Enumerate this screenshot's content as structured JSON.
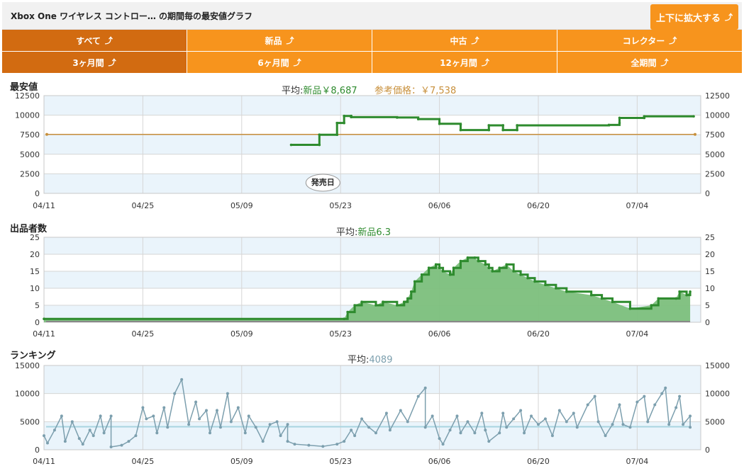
{
  "header": {
    "title": "Xbox One ワイヤレス コントロー…  の期間毎の最安値グラフ",
    "expand_label": "上下に拡大する",
    "expand_icon": "expand-arrow-icon"
  },
  "tabs_type": [
    {
      "label": "すべて",
      "active": true
    },
    {
      "label": "新品",
      "active": false
    },
    {
      "label": "中古",
      "active": false
    },
    {
      "label": "コレクター",
      "active": false
    }
  ],
  "tabs_period": [
    {
      "label": "3ヶ月間",
      "active": true
    },
    {
      "label": "6ヶ月間",
      "active": false
    },
    {
      "label": "12ヶ月間",
      "active": false
    },
    {
      "label": "全期間",
      "active": false
    }
  ],
  "tab_icon": "trend-arrow-icon",
  "colors": {
    "accent": "#f7941d",
    "accent_active": "#d26b11",
    "green": "#2e8b2e",
    "ref": "#c8903c",
    "rank": "#7c9fae"
  },
  "chart_data": [
    {
      "type": "line",
      "title": "最安値",
      "avg_prefix": "平均:",
      "avg_label": "新品￥8,687",
      "ref_label": "参考価格：￥7,538",
      "ylim": [
        0,
        12500
      ],
      "yticks": [
        0,
        2500,
        5000,
        7500,
        10000,
        12500
      ],
      "xticks": [
        "04/11",
        "04/25",
        "05/09",
        "05/23",
        "06/06",
        "06/20",
        "07/04"
      ],
      "annotation": {
        "label": "発売日",
        "x": 39.5
      },
      "reference": {
        "name": "参考価格",
        "value": 7538
      },
      "series": [
        {
          "name": "新品",
          "points": [
            [
              35,
              6200
            ],
            [
              39,
              6200
            ],
            [
              39,
              7500
            ],
            [
              41.5,
              7500
            ],
            [
              41.5,
              9000
            ],
            [
              42.5,
              9000
            ],
            [
              42.5,
              9900
            ],
            [
              43.5,
              9900
            ],
            [
              43.5,
              9750
            ],
            [
              50,
              9700
            ],
            [
              53,
              9500
            ],
            [
              56,
              8900
            ],
            [
              59,
              8800
            ],
            [
              59,
              8100
            ],
            [
              63,
              8100
            ],
            [
              63,
              8700
            ],
            [
              65,
              8700
            ],
            [
              65,
              8100
            ],
            [
              67,
              8100
            ],
            [
              67,
              8700
            ],
            [
              80,
              8750
            ],
            [
              81.5,
              9000
            ],
            [
              81.5,
              9650
            ],
            [
              85,
              9650
            ],
            [
              85,
              9850
            ],
            [
              92,
              9850
            ]
          ]
        }
      ]
    },
    {
      "type": "area",
      "title": "出品者数",
      "avg_prefix": "平均:",
      "avg_label": "新品6.3",
      "ylim": [
        0,
        25
      ],
      "yticks": [
        0,
        5,
        10,
        15,
        20,
        25
      ],
      "xticks": [
        "04/11",
        "04/25",
        "05/09",
        "05/23",
        "06/06",
        "06/20",
        "07/04"
      ],
      "series": [
        {
          "name": "新品",
          "points": [
            [
              0,
              1
            ],
            [
              42.5,
              1
            ],
            [
              43,
              3
            ],
            [
              44,
              5
            ],
            [
              45,
              6
            ],
            [
              47,
              5
            ],
            [
              48,
              6
            ],
            [
              50,
              5
            ],
            [
              51,
              6
            ],
            [
              51.5,
              7
            ],
            [
              52,
              9
            ],
            [
              52.5,
              12
            ],
            [
              53.5,
              14
            ],
            [
              54.5,
              16
            ],
            [
              55.5,
              17
            ],
            [
              56,
              16
            ],
            [
              56.5,
              15
            ],
            [
              57.5,
              14
            ],
            [
              58,
              16
            ],
            [
              59,
              18
            ],
            [
              60,
              19
            ],
            [
              61,
              19
            ],
            [
              61.5,
              18
            ],
            [
              62.5,
              17
            ],
            [
              63,
              16
            ],
            [
              63.5,
              15
            ],
            [
              64.5,
              16
            ],
            [
              65.5,
              17
            ],
            [
              66.5,
              15
            ],
            [
              67.5,
              14
            ],
            [
              68.5,
              13
            ],
            [
              69.5,
              12
            ],
            [
              71,
              11
            ],
            [
              72.5,
              10
            ],
            [
              74,
              9
            ],
            [
              77.5,
              8
            ],
            [
              79,
              7
            ],
            [
              80.5,
              6
            ],
            [
              83,
              4
            ],
            [
              86,
              5
            ],
            [
              87,
              7
            ],
            [
              89.5,
              7
            ],
            [
              90,
              9
            ],
            [
              91,
              8
            ],
            [
              91.5,
              9
            ]
          ]
        }
      ]
    },
    {
      "type": "line",
      "title": "ランキング",
      "avg_prefix": "平均:",
      "avg_label": "4089",
      "avg_value": 4089,
      "ylim": [
        0,
        15000
      ],
      "yticks": [
        0,
        5000,
        10000,
        15000
      ],
      "xticks": [
        "04/11",
        "04/25",
        "05/09",
        "05/23",
        "06/06",
        "06/20",
        "07/04"
      ],
      "series": [
        {
          "name": "ランキング",
          "points": [
            [
              0,
              2500
            ],
            [
              0.5,
              1200
            ],
            [
              1.5,
              3500
            ],
            [
              2.5,
              6000
            ],
            [
              3,
              1500
            ],
            [
              4,
              5000
            ],
            [
              5,
              2000
            ],
            [
              5.5,
              1000
            ],
            [
              6.5,
              3500
            ],
            [
              7,
              2500
            ],
            [
              8,
              6000
            ],
            [
              8.5,
              3000
            ],
            [
              9.5,
              6000
            ],
            [
              9.5,
              500
            ],
            [
              11,
              800
            ],
            [
              12,
              1500
            ],
            [
              13,
              2500
            ],
            [
              14,
              7500
            ],
            [
              14.5,
              5500
            ],
            [
              15.5,
              6000
            ],
            [
              16,
              3000
            ],
            [
              17,
              7500
            ],
            [
              17.5,
              4000
            ],
            [
              18.5,
              10000
            ],
            [
              19.5,
              12500
            ],
            [
              20.5,
              4500
            ],
            [
              21.5,
              8500
            ],
            [
              22,
              5500
            ],
            [
              23,
              7000
            ],
            [
              23.5,
              3000
            ],
            [
              24.5,
              7000
            ],
            [
              25,
              4000
            ],
            [
              26,
              10000
            ],
            [
              26.5,
              5000
            ],
            [
              27.5,
              7500
            ],
            [
              28.5,
              3000
            ],
            [
              29,
              6000
            ],
            [
              30,
              4000
            ],
            [
              31,
              1500
            ],
            [
              32,
              4500
            ],
            [
              33,
              5000
            ],
            [
              33.5,
              2500
            ],
            [
              34.5,
              4500
            ],
            [
              34.5,
              1500
            ],
            [
              35.5,
              1000
            ],
            [
              37.5,
              800
            ],
            [
              39.5,
              600
            ],
            [
              41.5,
              1000
            ],
            [
              42.5,
              1500
            ],
            [
              43.5,
              3500
            ],
            [
              44,
              2500
            ],
            [
              45,
              5500
            ],
            [
              46,
              4000
            ],
            [
              47,
              3000
            ],
            [
              48.5,
              6500
            ],
            [
              49,
              3500
            ],
            [
              50.5,
              7000
            ],
            [
              51.5,
              5000
            ],
            [
              53,
              9500
            ],
            [
              54,
              11000
            ],
            [
              54,
              4000
            ],
            [
              55,
              6000
            ],
            [
              56,
              2000
            ],
            [
              56.5,
              1000
            ],
            [
              57.5,
              3500
            ],
            [
              58.5,
              6000
            ],
            [
              59,
              3000
            ],
            [
              60,
              5000
            ],
            [
              61,
              3000
            ],
            [
              62,
              6500
            ],
            [
              62.5,
              3500
            ],
            [
              63,
              1500
            ],
            [
              64.5,
              3000
            ],
            [
              65,
              6500
            ],
            [
              65.5,
              4000
            ],
            [
              66.5,
              5500
            ],
            [
              67.5,
              7000
            ],
            [
              68,
              3000
            ],
            [
              69,
              6000
            ],
            [
              70,
              4500
            ],
            [
              71,
              5500
            ],
            [
              72,
              2500
            ],
            [
              73,
              7000
            ],
            [
              74,
              5000
            ],
            [
              75,
              6500
            ],
            [
              75.5,
              4000
            ],
            [
              77,
              8000
            ],
            [
              78,
              9500
            ],
            [
              78.5,
              5000
            ],
            [
              79.5,
              2500
            ],
            [
              80.5,
              4500
            ],
            [
              81.5,
              8000
            ],
            [
              82,
              4500
            ],
            [
              83,
              4000
            ],
            [
              84,
              8500
            ],
            [
              85,
              9500
            ],
            [
              85.5,
              5000
            ],
            [
              86.5,
              8000
            ],
            [
              87.5,
              10000
            ],
            [
              88,
              11000
            ],
            [
              88.5,
              4500
            ],
            [
              89.5,
              7500
            ],
            [
              90,
              9500
            ],
            [
              90.5,
              4500
            ],
            [
              91.5,
              6000
            ],
            [
              91.5,
              4000
            ]
          ]
        }
      ]
    }
  ]
}
